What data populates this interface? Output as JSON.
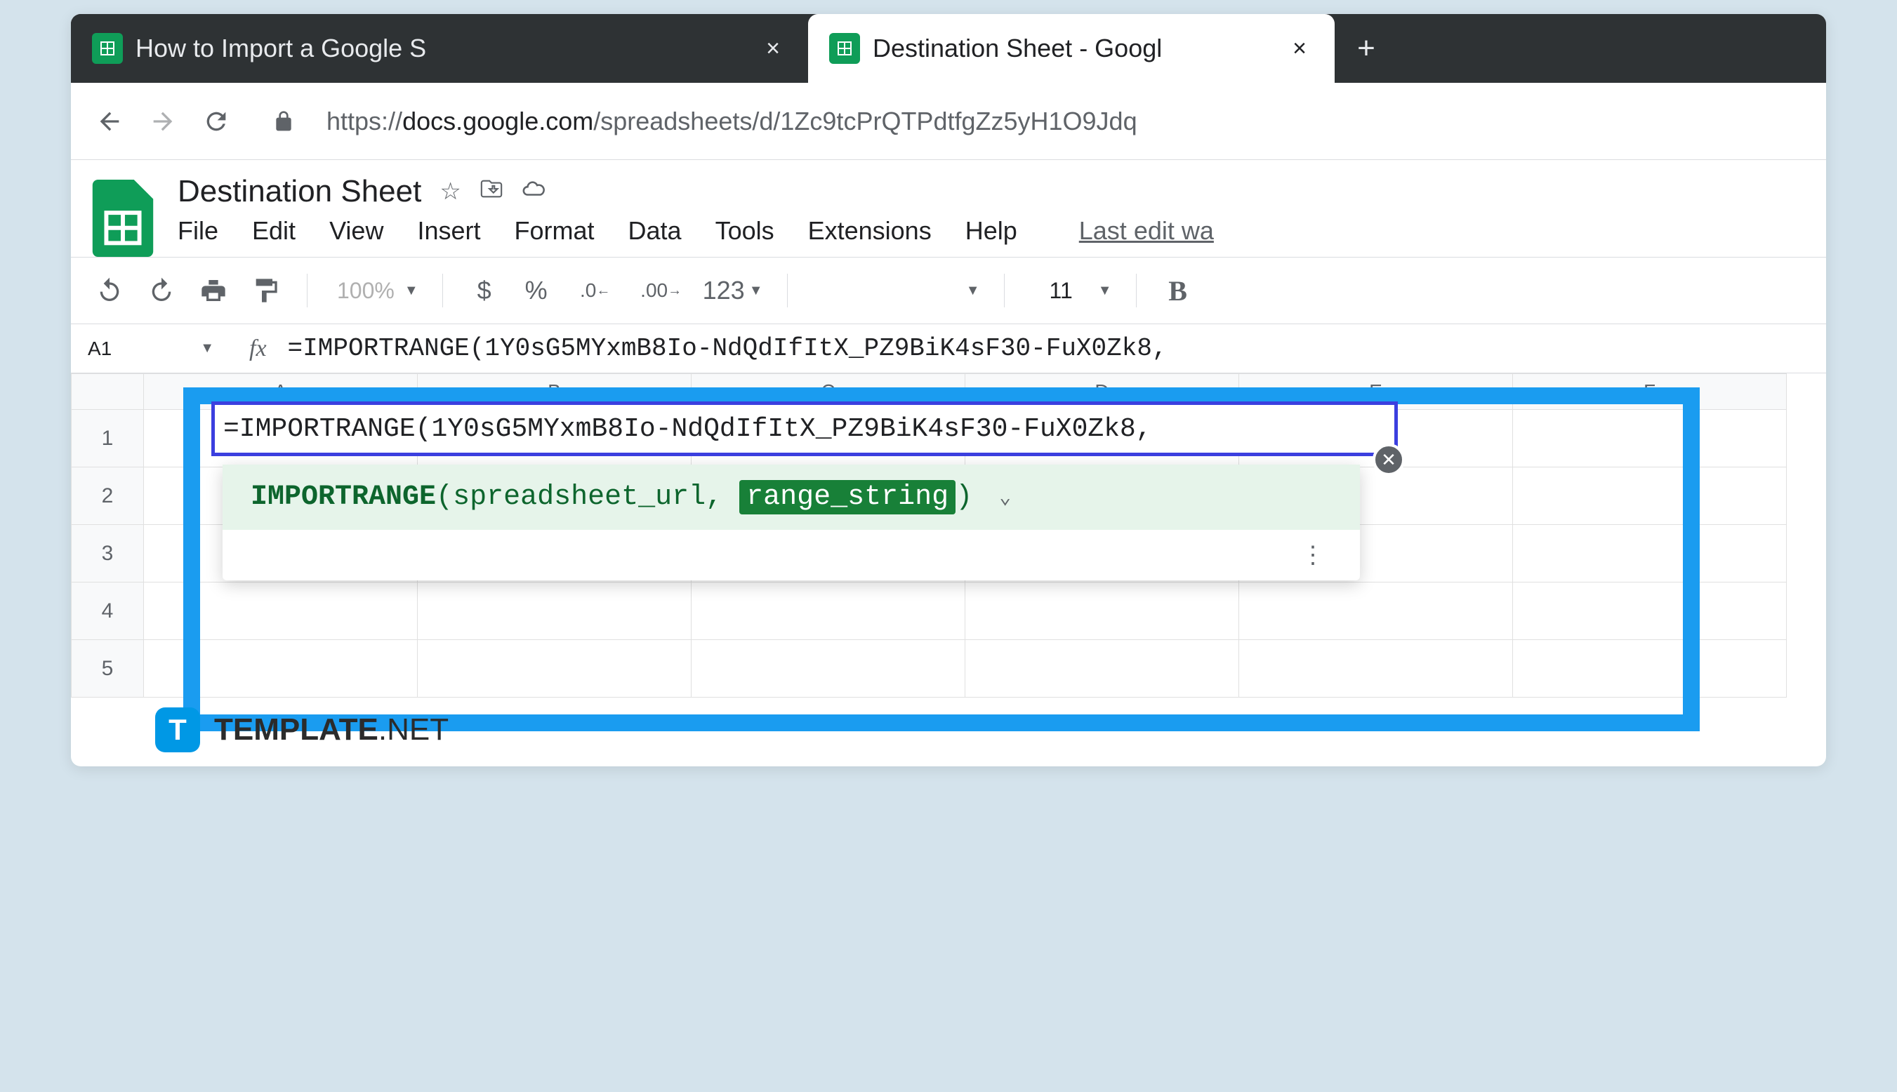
{
  "browser": {
    "tabs": [
      {
        "title": "How to Import a Google S",
        "active": false
      },
      {
        "title": "Destination Sheet - Googl",
        "active": true
      }
    ],
    "url_scheme": "https://",
    "url_host": "docs.google.com",
    "url_path": "/spreadsheets/d/1Zc9tcPrQTPdtfgZz5yH1O9Jdq"
  },
  "doc": {
    "title": "Destination Sheet",
    "menus": [
      "File",
      "Edit",
      "View",
      "Insert",
      "Format",
      "Data",
      "Tools",
      "Extensions",
      "Help"
    ],
    "last_edit": "Last edit wa"
  },
  "toolbar": {
    "zoom": "100%",
    "currency": "$",
    "percent": "%",
    "dec_dec": ".0",
    "inc_dec": ".00",
    "number_fmt": "123",
    "font_size": "11",
    "bold": "B"
  },
  "formula": {
    "name_box": "A1",
    "text": "=IMPORTRANGE(1Y0sG5MYxmB8Io-NdQdIfItX_PZ9BiK4sF30-FuX0Zk8,"
  },
  "cell_edit": {
    "text": "=IMPORTRANGE(1Y0sG5MYxmB8Io-NdQdIfItX_PZ9BiK4sF30-FuX0Zk8,"
  },
  "hint": {
    "fn": "IMPORTRANGE",
    "open": "(",
    "param1": "spreadsheet_url",
    "sep": ", ",
    "param2": "range_string",
    "close": ")"
  },
  "grid": {
    "cols": [
      "A",
      "B",
      "C",
      "D",
      "E",
      "F"
    ],
    "rows": [
      "1",
      "2",
      "3",
      "4",
      "5"
    ]
  },
  "watermark": {
    "brand": "TEMPLATE",
    "suffix": ".NET",
    "logo": "T"
  }
}
